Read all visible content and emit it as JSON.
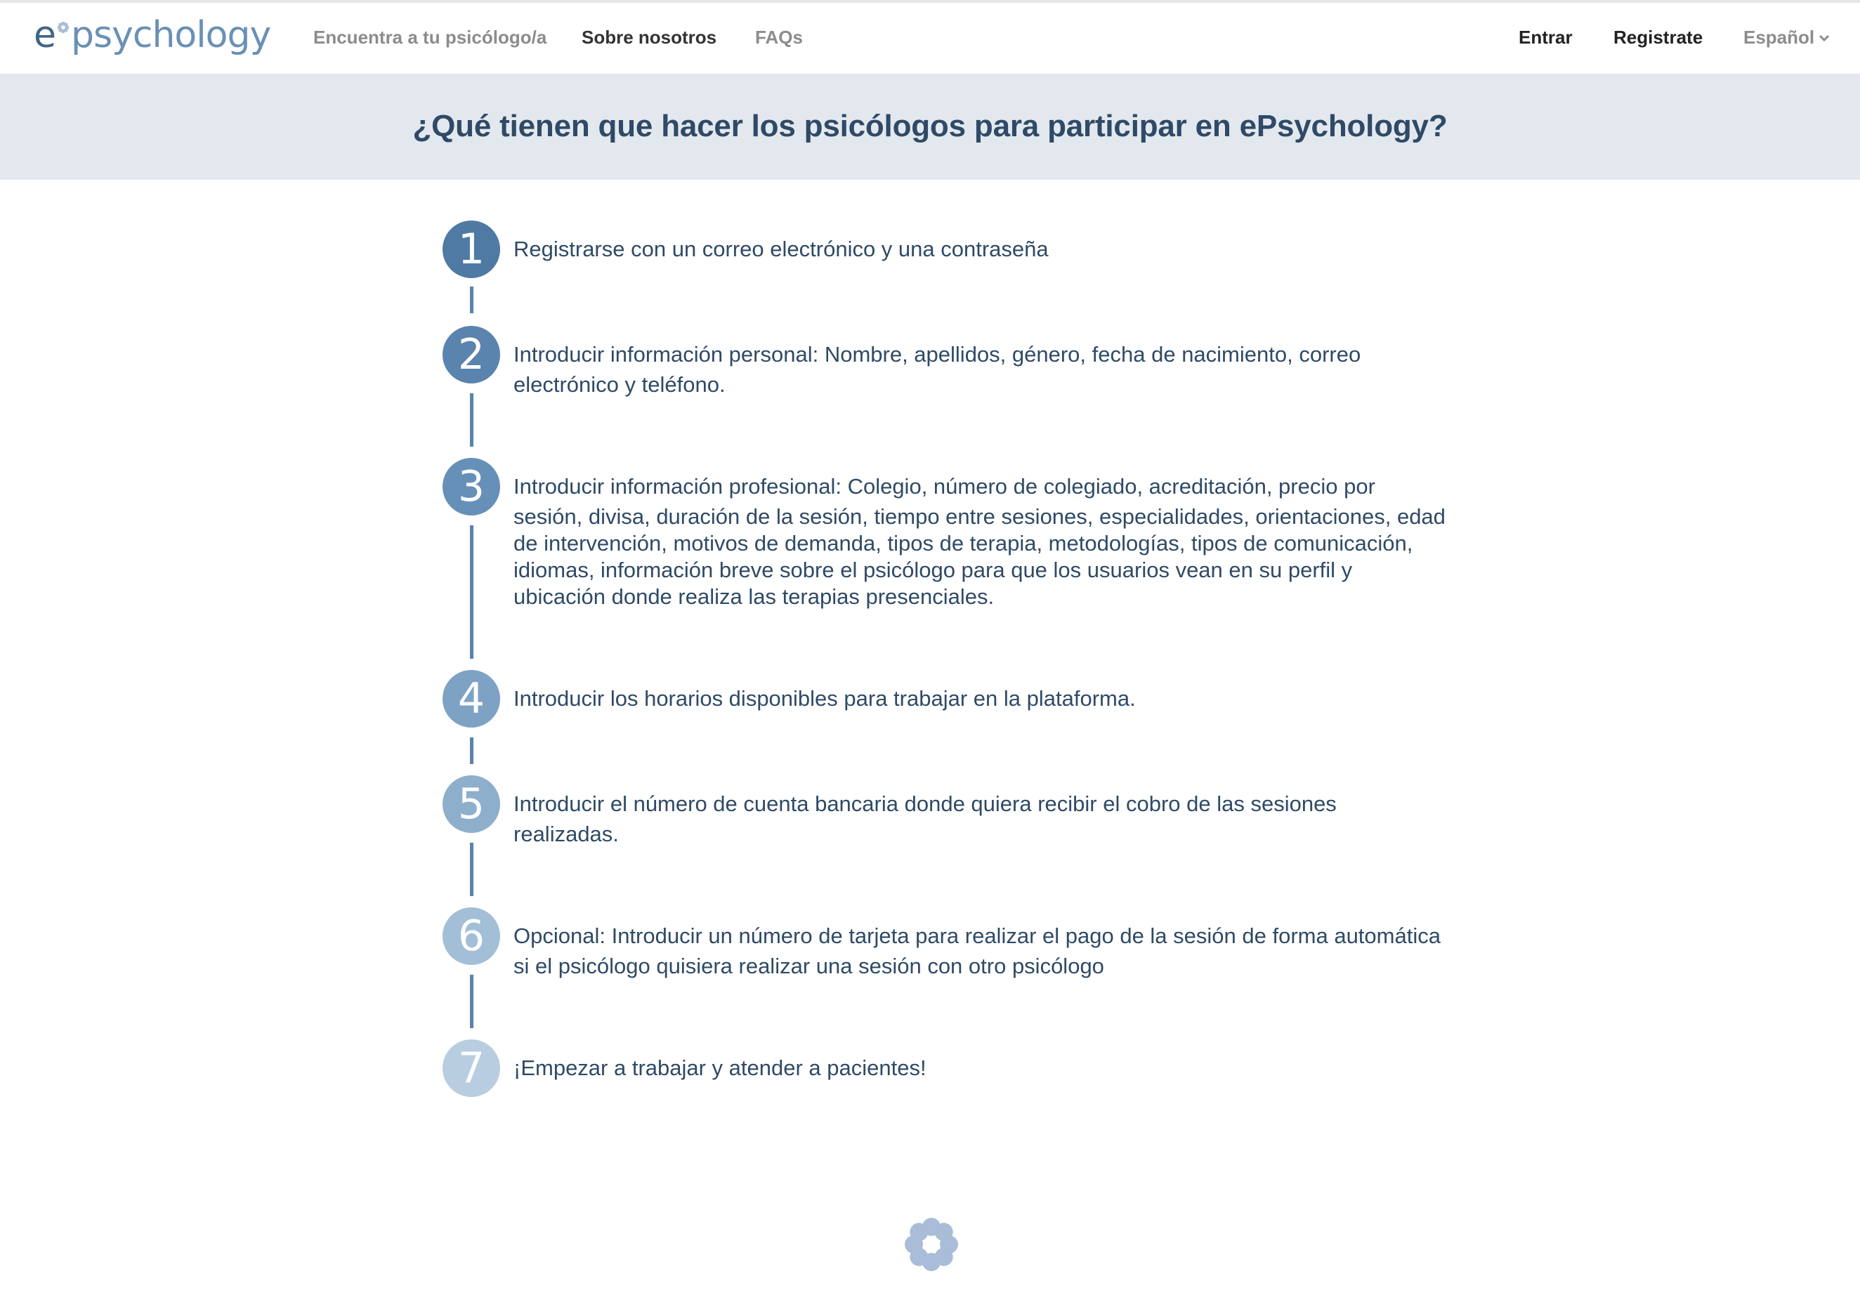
{
  "brand": {
    "logo_e": "e",
    "logo_rest": "psychology",
    "accent_color": "#5982ad"
  },
  "nav": {
    "find": "Encuentra a tu psicólogo/a",
    "about": "Sobre nosotros",
    "faqs": "FAQs",
    "login": "Entrar",
    "register": "Registrate",
    "language": "Español",
    "language_icon": "chevron-down-icon"
  },
  "banner": {
    "title": "¿Qué tienen que hacer los psicólogos para participar en ePsychology?"
  },
  "steps": [
    {
      "number": "1",
      "first": "Registrarse con un correo electrónico y una contraseña",
      "rest": "",
      "color": "#4f7aa4"
    },
    {
      "number": "2",
      "first": "Introducir información personal: Nombre, apellidos, género, fecha de nacimiento, correo",
      "rest": "electrónico y teléfono.",
      "color": "#5a84ad"
    },
    {
      "number": "3",
      "first": "Introducir información profesional: Colegio, número de colegiado, acreditación, precio por",
      "rest": "sesión, divisa, duración de la sesión, tiempo entre sesiones, especialidades, orientaciones, edad de intervención, motivos de demanda, tipos de terapia, metodologías, tipos de comunicación, idiomas, información breve sobre el psicólogo para que los usuarios vean en su perfil y ubicación donde realiza las terapias presenciales.",
      "color": "#6690b7"
    },
    {
      "number": "4",
      "first": "Introducir los horarios disponibles para trabajar en la plataforma.",
      "rest": "",
      "color": "#7ea2c4"
    },
    {
      "number": "5",
      "first": "Introducir el número de cuenta bancaria donde quiera recibir el cobro de las sesiones",
      "rest": "realizadas.",
      "color": "#8eafcc"
    },
    {
      "number": "6",
      "first": "Opcional: Introducir un número de tarjeta para realizar el pago de la sesión de forma automática",
      "rest": "si el psicólogo quisiera realizar una sesión con otro psicólogo",
      "color": "#a3bfd7"
    },
    {
      "number": "7",
      "first": "¡Empezar a trabajar y atender a pacientes!",
      "rest": "",
      "color": "#b8cee0"
    }
  ],
  "footer": {
    "icon": "flower-logo-icon",
    "icon_color": "#a9bdd8"
  }
}
